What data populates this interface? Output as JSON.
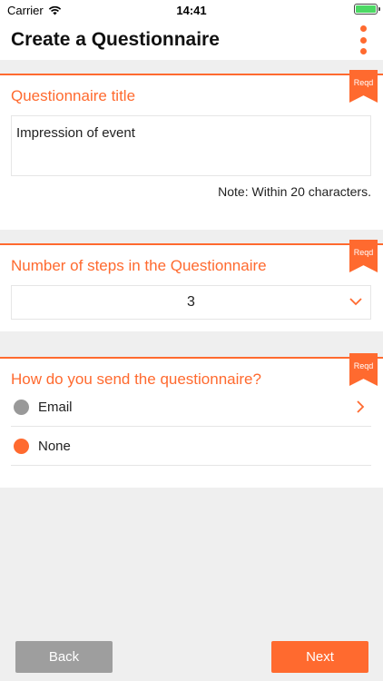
{
  "status_bar": {
    "carrier": "Carrier",
    "time": "14:41"
  },
  "header": {
    "title": "Create a Questionnaire"
  },
  "reqd_label": "Reqd",
  "sections": {
    "title": {
      "label": "Questionnaire title",
      "value": "Impression of event",
      "note": "Note: Within 20 characters."
    },
    "steps": {
      "label": "Number of steps in the Questionnaire",
      "selected": "3"
    },
    "send": {
      "label": "How do you send the questionnaire?",
      "options": [
        {
          "label": "Email",
          "selected": false
        },
        {
          "label": "None",
          "selected": true
        }
      ]
    }
  },
  "footer": {
    "back_label": "Back",
    "next_label": "Next"
  },
  "colors": {
    "accent": "#ff6a2f",
    "back_button": "#9e9e9e",
    "radio_unselected": "#999999"
  }
}
